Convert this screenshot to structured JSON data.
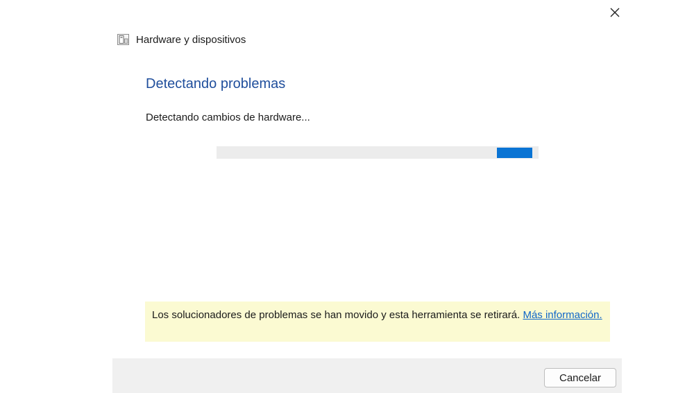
{
  "window": {
    "title": "Hardware y dispositivos",
    "app_icon": "hardware-troubleshooter-icon",
    "close_icon": "close-icon"
  },
  "main": {
    "heading": "Detectando problemas",
    "status": "Detectando cambios de hardware...",
    "progress": {
      "mode": "indeterminate",
      "chunk_start": 0.87,
      "chunk_end": 0.98
    }
  },
  "notice": {
    "text": "Los solucionadores de problemas se han movido y esta herramienta se retirará. ",
    "link_label": "Más información."
  },
  "footer": {
    "cancel_label": "Cancelar"
  },
  "colors": {
    "heading": "#1f4e9c",
    "progress_fill": "#0a74d4",
    "notice_background": "#fbfad2",
    "link": "#0f66c8"
  }
}
